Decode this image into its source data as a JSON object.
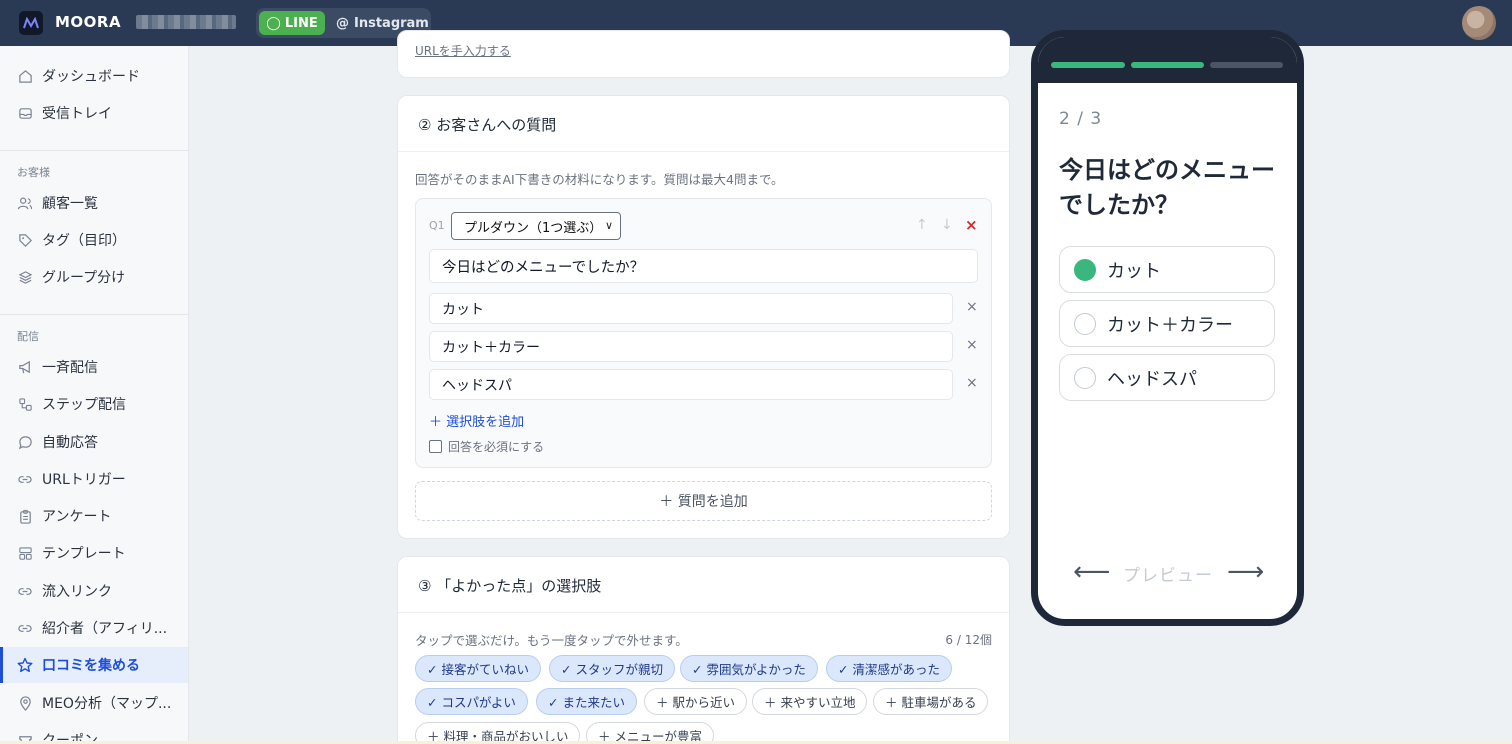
{
  "header": {
    "brand": "MOORA",
    "channels": [
      {
        "label": "LINE",
        "active": true
      },
      {
        "label": "Instagram",
        "active": false
      }
    ]
  },
  "sidebar": {
    "top_items": [
      {
        "label": "ダッシュボード",
        "icon": "home-icon"
      },
      {
        "label": "受信トレイ",
        "icon": "inbox-icon"
      }
    ],
    "section_customers": "お客様",
    "customer_items": [
      {
        "label": "顧客一覧",
        "icon": "users-icon"
      },
      {
        "label": "タグ（目印）",
        "icon": "tag-icon"
      },
      {
        "label": "グループ分け",
        "icon": "layers-icon"
      }
    ],
    "section_delivery": "配信",
    "delivery_items": [
      {
        "label": "一斉配信",
        "icon": "megaphone-icon"
      },
      {
        "label": "ステップ配信",
        "icon": "steps-icon"
      },
      {
        "label": "自動応答",
        "icon": "chat-icon"
      },
      {
        "label": "URLトリガー",
        "icon": "link-icon"
      },
      {
        "label": "アンケート",
        "icon": "clipboard-icon"
      },
      {
        "label": "テンプレート",
        "icon": "template-icon"
      },
      {
        "label": "流入リンク",
        "icon": "link-icon"
      },
      {
        "label": "紹介者（アフィリ...",
        "icon": "link-icon"
      },
      {
        "label": "口コミを集める",
        "icon": "star-icon",
        "active": true
      },
      {
        "label": "MEO分析（マップ...",
        "icon": "pin-icon"
      },
      {
        "label": "クーポン",
        "icon": "ticket-icon"
      }
    ]
  },
  "main": {
    "top_card_link": "URLを手入力する",
    "questions_card": {
      "title": "② お客さんへの質問",
      "hint": "回答がそのままAI下書きの材料になります。質問は最大4問まで。",
      "q_label": "Q1",
      "type_select": "プルダウン（1つ選ぶ）",
      "question_text": "今日はどのメニューでしたか？",
      "options": [
        "カット",
        "カット＋カラー",
        "ヘッドスパ"
      ],
      "add_option": "＋ 選択肢を追加",
      "required_label": "回答を必須にする",
      "add_question": "＋ 質問を追加"
    },
    "goodpoints_card": {
      "title": "③ 「よかった点」の選択肢",
      "hint": "タップで選ぶだけ。もう一度タップで外せます。",
      "count": "6 / 12個",
      "chips_row1": [
        {
          "label": "✓ 接客がていねい",
          "on": true
        },
        {
          "label": "✓ スタッフが親切",
          "on": true
        },
        {
          "label": "✓ 雰囲気がよかった",
          "on": true
        },
        {
          "label": "✓ 清潔感があった",
          "on": true
        }
      ],
      "chips_row2": [
        {
          "label": "✓ コスパがよい",
          "on": true
        },
        {
          "label": "✓ また来たい",
          "on": true
        },
        {
          "label": "＋ 駅から近い",
          "on": false
        },
        {
          "label": "＋ 来やすい立地",
          "on": false
        },
        {
          "label": "＋ 駐車場がある",
          "on": false
        }
      ],
      "chips_row3": [
        {
          "label": "＋ 料理・商品がおいしい",
          "on": false
        },
        {
          "label": "＋ メニューが豊富",
          "on": false
        }
      ]
    }
  },
  "preview": {
    "step": "2 / 3",
    "progress_steps_done": 2,
    "progress_steps_total": 3,
    "question": "今日はどのメニューでしたか？",
    "options": [
      {
        "label": "カット",
        "selected": true
      },
      {
        "label": "カット＋カラー",
        "selected": false
      },
      {
        "label": "ヘッドスパ",
        "selected": false
      }
    ],
    "nav_label": "プレビュー",
    "accent_color": "#3bb77e"
  }
}
